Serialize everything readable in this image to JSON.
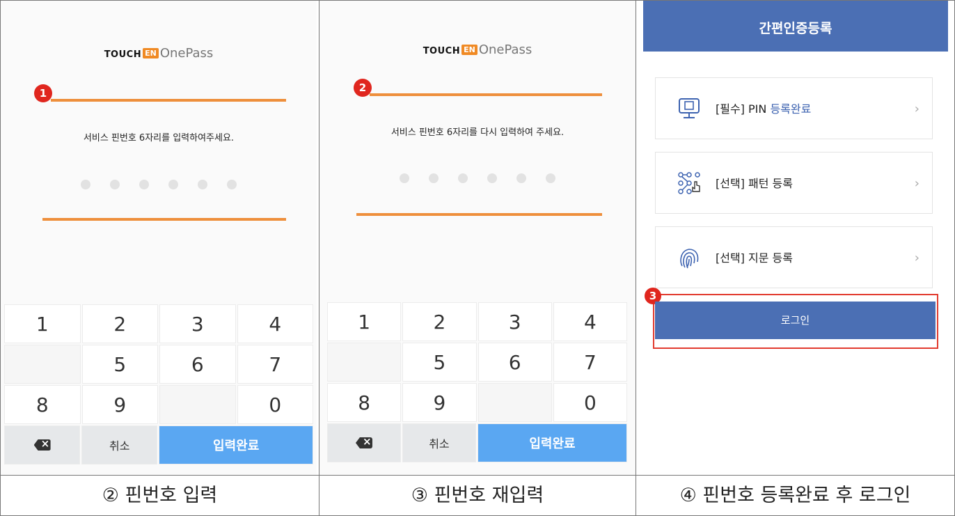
{
  "brand": {
    "touch": "TOUCH",
    "en": "EN",
    "onepass": "OnePass"
  },
  "panel1": {
    "step": "1",
    "instruction": "서비스 핀번호 6자리를 입력하여주세요.",
    "caption": "② 핀번호 입력"
  },
  "panel2": {
    "step": "2",
    "instruction": "서비스 핀번호 6자리를 다시 입력하여 주세요.",
    "caption": "③ 핀번호 재입력"
  },
  "keypad": {
    "rows": [
      [
        "1",
        "2",
        "3",
        "4"
      ],
      [
        "",
        "5",
        "6",
        "7"
      ],
      [
        "8",
        "9",
        "",
        "0"
      ]
    ],
    "cancel": "취소",
    "submit": "입력완료"
  },
  "panel3": {
    "title": "간편인증등록",
    "items": [
      {
        "prefix": "[필수] PIN ",
        "status": "등록완료",
        "icon": "pin-device-icon"
      },
      {
        "prefix": "[선택] 패턴 등록",
        "status": "",
        "icon": "pattern-icon"
      },
      {
        "prefix": "[선택] 지문 등록",
        "status": "",
        "icon": "fingerprint-icon"
      }
    ],
    "step": "3",
    "login": "로그인",
    "caption": "④ 핀번호 등록완료 후 로그인"
  },
  "colors": {
    "accent_orange": "#ee8f3c",
    "brand_blue": "#4b6fb4",
    "key_blue": "#5aa7f2",
    "step_red": "#e0261e"
  }
}
